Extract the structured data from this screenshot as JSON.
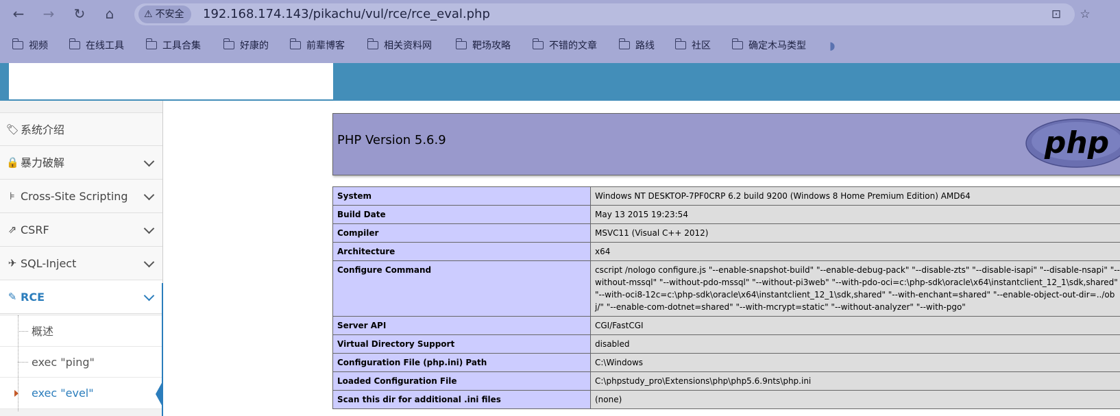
{
  "browser": {
    "security_label": "不安全",
    "url": "192.168.174.143/pikachu/vul/rce/rce_eval.php",
    "bookmarks": [
      "视频",
      "在线工具",
      "工具合集",
      "好康的",
      "前辈博客",
      "相关资料网",
      "靶场攻略",
      "不错的文章",
      "路线",
      "社区",
      "确定木马类型"
    ]
  },
  "sidebar": {
    "items": [
      {
        "label": "系统介绍",
        "icon": "tags-icon"
      },
      {
        "label": "暴力破解",
        "icon": "lock-icon"
      },
      {
        "label": "Cross-Site Scripting",
        "icon": "sitemap-icon"
      },
      {
        "label": "CSRF",
        "icon": "share-icon"
      },
      {
        "label": "SQL-Inject",
        "icon": "plane-icon"
      },
      {
        "label": "RCE",
        "icon": "pencil-icon"
      }
    ],
    "sub_items": [
      {
        "label": "概述"
      },
      {
        "label": "exec \"ping\""
      },
      {
        "label": "exec \"evel\""
      }
    ]
  },
  "phpinfo": {
    "title": "PHP Version 5.6.9",
    "logo_text": "php",
    "rows": [
      {
        "key": "System",
        "value": "Windows NT DESKTOP-7PF0CRP 6.2 build 9200 (Windows 8 Home Premium Edition) AMD64"
      },
      {
        "key": "Build Date",
        "value": "May 13 2015 19:23:54"
      },
      {
        "key": "Compiler",
        "value": "MSVC11 (Visual C++ 2012)"
      },
      {
        "key": "Architecture",
        "value": "x64"
      },
      {
        "key": "Configure Command",
        "value": "cscript /nologo configure.js \"--enable-snapshot-build\" \"--enable-debug-pack\" \"--disable-zts\" \"--disable-isapi\" \"--disable-nsapi\" \"--without-mssql\" \"--without-pdo-mssql\" \"--without-pi3web\" \"--with-pdo-oci=c:\\php-sdk\\oracle\\x64\\instantclient_12_1\\sdk,shared\" \"--with-oci8-12c=c:\\php-sdk\\oracle\\x64\\instantclient_12_1\\sdk,shared\" \"--with-enchant=shared\" \"--enable-object-out-dir=../obj/\" \"--enable-com-dotnet=shared\" \"--with-mcrypt=static\" \"--without-analyzer\" \"--with-pgo\""
      },
      {
        "key": "Server API",
        "value": "CGI/FastCGI"
      },
      {
        "key": "Virtual Directory Support",
        "value": "disabled"
      },
      {
        "key": "Configuration File (php.ini) Path",
        "value": "C:\\Windows"
      },
      {
        "key": "Loaded Configuration File",
        "value": "C:\\phpstudy_pro\\Extensions\\php\\php5.6.9nts\\php.ini"
      },
      {
        "key": "Scan this dir for additional .ini files",
        "value": "(none)"
      }
    ]
  },
  "colors": {
    "chrome": "#a5a9d4",
    "header": "#438eb9",
    "accent": "#2b7dbc",
    "php_header": "#9999cc",
    "php_key": "#ccccff",
    "php_value": "#dddddd"
  }
}
